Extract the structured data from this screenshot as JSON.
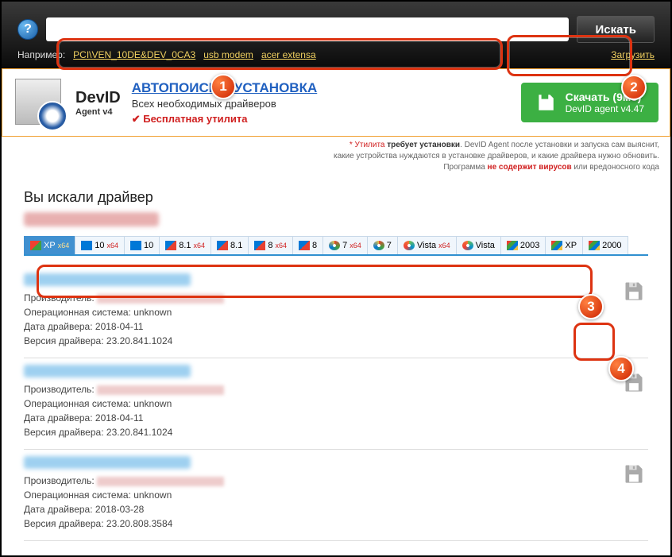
{
  "header": {
    "search_value": "",
    "search_button": "Искать",
    "example_label": "Например:",
    "example_links": [
      "PCI\\VEN_10DE&DEV_0CA3",
      "usb modem",
      "acer extensa"
    ],
    "upload_link": "Загрузить"
  },
  "promo": {
    "brand": "DevID",
    "agent": "Agent v4",
    "title": "АВТОПОИСК И УСТАНОВКА",
    "subtitle": "Всех необходимых драйверов",
    "free": "Бесплатная утилита",
    "download_title": "Скачать (9мб)",
    "download_sub": "DevID agent v4.47"
  },
  "note": {
    "line1_a": "* Утилита ",
    "line1_b": "требует установки",
    "line1_c": ". DevID Agent после установки и запуска сам выяснит,",
    "line2": "какие устройства нуждаются в установке драйверов, и какие драйвера нужно обновить.",
    "line3_a": "Программа ",
    "line3_b": "не содержит вирусов",
    "line3_c": " или вредоносного кода"
  },
  "searched_label": "Вы искали драйвер",
  "os_tabs": [
    {
      "label": "XP",
      "x64": true,
      "flag": "flag-xp",
      "active": true
    },
    {
      "label": "10",
      "x64": true,
      "flag": "flag-10"
    },
    {
      "label": "10",
      "x64": false,
      "flag": "flag-10"
    },
    {
      "label": "8.1",
      "x64": true,
      "flag": "flag-8"
    },
    {
      "label": "8.1",
      "x64": false,
      "flag": "flag-8"
    },
    {
      "label": "8",
      "x64": true,
      "flag": "flag-8"
    },
    {
      "label": "8",
      "x64": false,
      "flag": "flag-8"
    },
    {
      "label": "7",
      "x64": true,
      "flag": "flag-7"
    },
    {
      "label": "7",
      "x64": false,
      "flag": "flag-7"
    },
    {
      "label": "Vista",
      "x64": true,
      "flag": "flag-v"
    },
    {
      "label": "Vista",
      "x64": false,
      "flag": "flag-v"
    },
    {
      "label": "2003",
      "x64": false,
      "flag": "flag-old"
    },
    {
      "label": "XP",
      "x64": false,
      "flag": "flag-old"
    },
    {
      "label": "2000",
      "x64": false,
      "flag": "flag-old"
    }
  ],
  "labels": {
    "manufacturer": "Производитель:",
    "os": "Операционная система:",
    "date": "Дата драйвера:",
    "version": "Версия драйвера:"
  },
  "drivers": [
    {
      "os": "unknown",
      "date": "2018-04-11",
      "version": "23.20.841.1024"
    },
    {
      "os": "unknown",
      "date": "2018-04-11",
      "version": "23.20.841.1024"
    },
    {
      "os": "unknown",
      "date": "2018-03-28",
      "version": "23.20.808.3584"
    }
  ]
}
